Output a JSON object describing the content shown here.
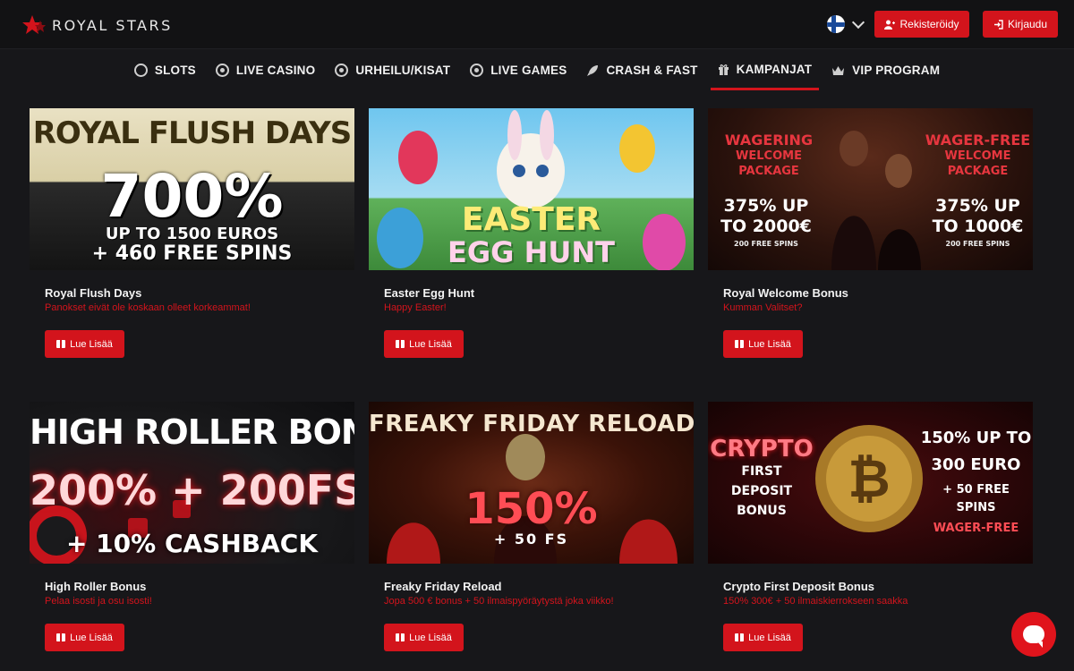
{
  "header": {
    "logo_text": "ROYAL STARS",
    "register_label": "Rekisteröidy",
    "login_label": "Kirjaudu",
    "language": "fi"
  },
  "nav": {
    "items": [
      {
        "label": "SLOTS",
        "icon": "slots-icon"
      },
      {
        "label": "LIVE CASINO",
        "icon": "chip-icon"
      },
      {
        "label": "URHEILU/KISAT",
        "icon": "gamepad-icon"
      },
      {
        "label": "LIVE GAMES",
        "icon": "wheel-icon"
      },
      {
        "label": "CRASH & FAST",
        "icon": "rocket-icon"
      },
      {
        "label": "KAMPANJAT",
        "icon": "gift-icon",
        "active": true
      },
      {
        "label": "VIP PROGRAM",
        "icon": "crown-icon"
      }
    ]
  },
  "promotions": [
    {
      "title": "Royal Flush Days",
      "subtitle": "Panokset eivät ole koskaan olleet korkeammat!",
      "button": "Lue Lisää",
      "banner": {
        "line1": "ROYAL FLUSH DAYS",
        "line2": "700%",
        "line3": "UP TO 1500 EUROS",
        "line4": "+ 460 FREE SPINS"
      }
    },
    {
      "title": "Easter Egg Hunt",
      "subtitle": "Happy Easter!",
      "button": "Lue Lisää",
      "banner": {
        "line1": "EASTER",
        "line2": "EGG HUNT"
      }
    },
    {
      "title": "Royal Welcome Bonus",
      "subtitle": "Kumman Valitset?",
      "button": "Lue Lisää",
      "banner": {
        "left_head": "WAGERING",
        "left_sub1": "WELCOME",
        "left_sub2": "PACKAGE",
        "left_amt1": "375% UP",
        "left_amt2": "TO 2000€",
        "left_fs": "200 FREE SPINS",
        "right_head": "WAGER-FREE",
        "right_sub1": "WELCOME",
        "right_sub2": "PACKAGE",
        "right_amt1": "375% UP",
        "right_amt2": "TO 1000€",
        "right_fs": "200 FREE SPINS"
      }
    },
    {
      "title": "High Roller Bonus",
      "subtitle": "Pelaa isosti ja osu isosti!",
      "button": "Lue Lisää",
      "banner": {
        "line1": "HIGH ROLLER BONUS",
        "line2": "200% + 200FS",
        "line3": "+ 10% CASHBACK"
      }
    },
    {
      "title": "Freaky Friday Reload",
      "subtitle": "Jopa 500 € bonus + 50 ilmaispyöräytystä joka viikko!",
      "button": "Lue Lisää",
      "banner": {
        "line1": "FREAKY FRIDAY RELOAD",
        "line2": "150%",
        "line3": "+ 50 FS"
      }
    },
    {
      "title": "Crypto First Deposit Bonus",
      "subtitle": "150% 300€ + 50 ilmaiskierrokseen saakka",
      "button": "Lue Lisää",
      "banner": {
        "left1": "CRYPTO",
        "left2": "FIRST",
        "left3": "DEPOSIT",
        "left4": "BONUS",
        "right1": "150% UP TO",
        "right2": "300 EURO",
        "right3": "+ 50 FREE",
        "right4": "SPINS",
        "right5": "WAGER-FREE"
      }
    }
  ],
  "colors": {
    "accent": "#d3141c",
    "background": "#17171a"
  }
}
